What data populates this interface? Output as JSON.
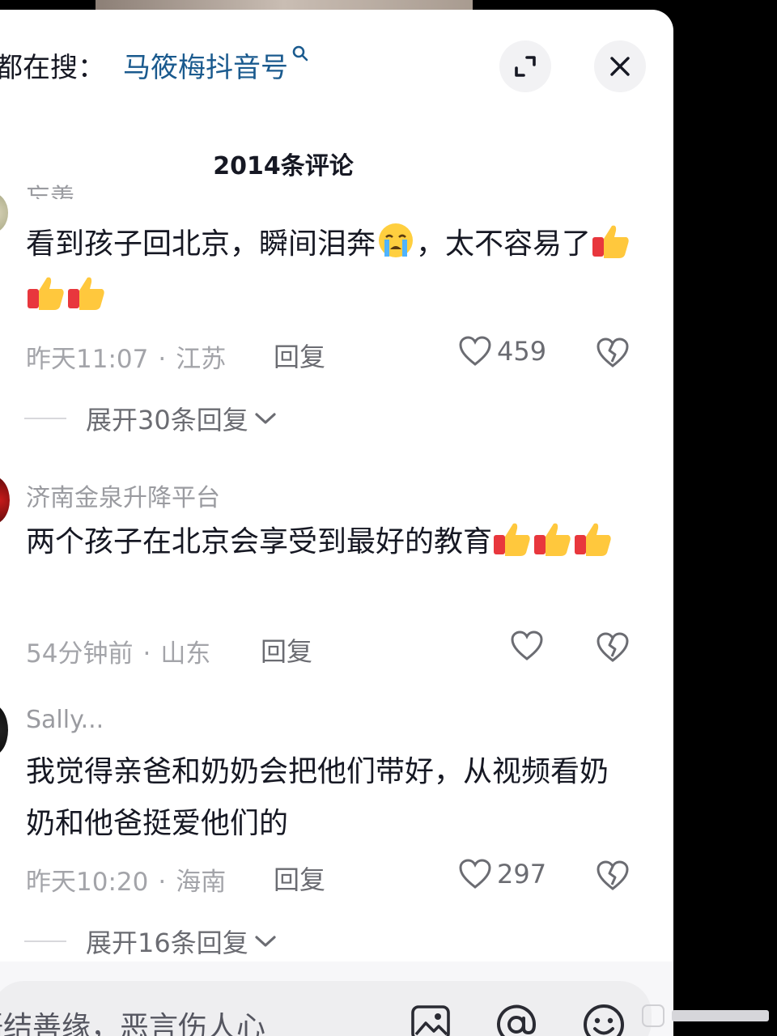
{
  "header": {
    "search_prefix": "都在搜：",
    "search_term": "马筱梅抖音号"
  },
  "comment_count_title": "2014条评论",
  "comments": [
    {
      "username": "忘羡",
      "text_parts": [
        "看到孩子回北京，瞬间泪奔",
        "，太不容易了"
      ],
      "time": "昨天11:07",
      "location": "江苏",
      "reply_label": "回复",
      "likes": "459",
      "expand_label": "展开30条回复"
    },
    {
      "username": "济南金泉升降平台",
      "text_parts": [
        "两个孩子在北京会享受到最好的教育"
      ],
      "time": "54分钟前",
      "location": "山东",
      "reply_label": "回复",
      "likes": ""
    },
    {
      "username": "Sally...",
      "text_parts": [
        "我觉得亲爸和奶奶会把他们带好，从视频看奶奶和他爸挺爱他们的"
      ],
      "time": "昨天10:20",
      "location": "海南",
      "reply_label": "回复",
      "likes": "297",
      "expand_label": "展开16条回复"
    }
  ],
  "input": {
    "placeholder": "善语结善缘，恶言伤人心"
  },
  "icons": {
    "expand": "expand-icon",
    "close": "close-icon",
    "like": "heart-icon",
    "dislike": "broken-heart-icon",
    "image": "image-icon",
    "mention": "at-icon",
    "emoji": "emoji-icon"
  },
  "colors": {
    "search_term": "#1a5a8e",
    "text": "#161823",
    "muted": "#a3a4a9"
  }
}
